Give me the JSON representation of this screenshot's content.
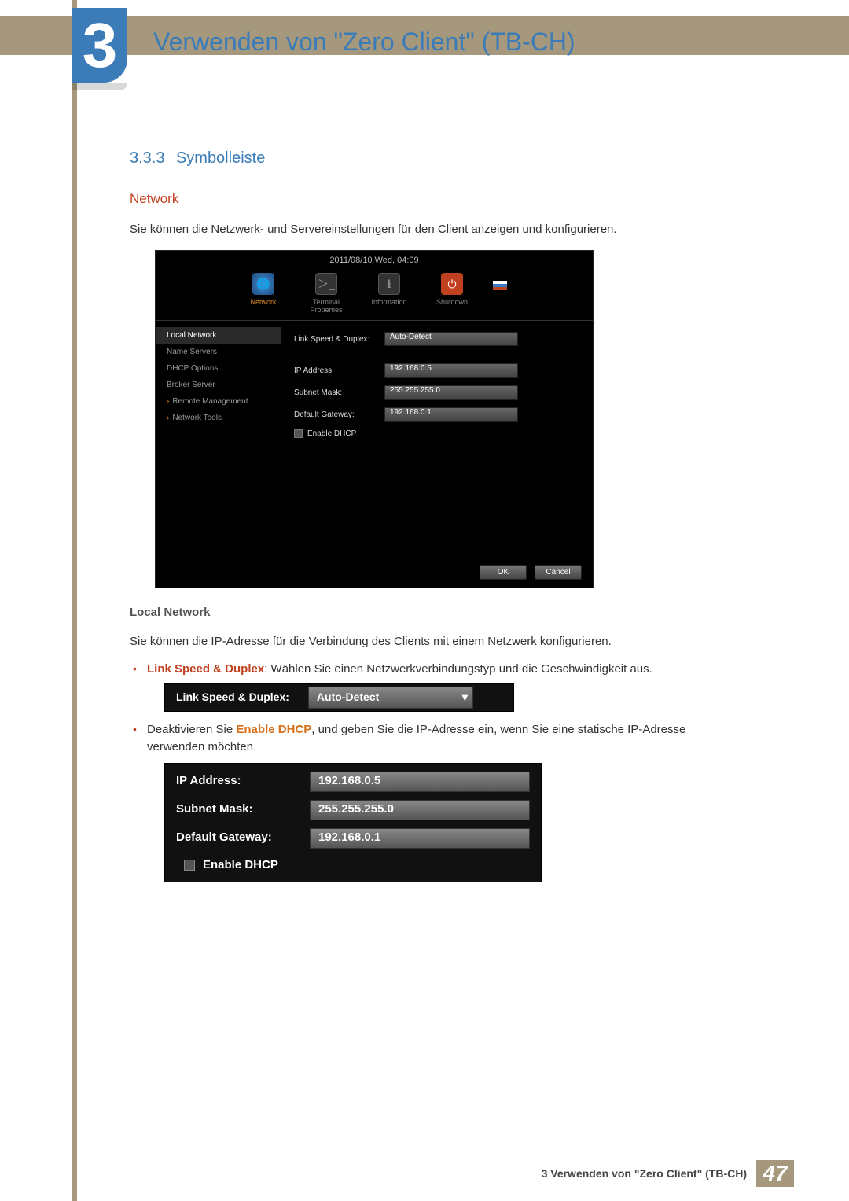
{
  "chapter": {
    "num": "3",
    "title": "Verwenden von \"Zero Client\" (TB-CH)"
  },
  "section": {
    "num": "3.3.3",
    "title": "Symbolleiste"
  },
  "networkHeading": "Network",
  "intro": "Sie können die Netzwerk- und Servereinstellungen für den Client anzeigen und konfigurieren.",
  "shot": {
    "datetime": "2011/08/10 Wed, 04:09",
    "toolbar": [
      "Network",
      "Terminal Properties",
      "Information",
      "Shutdown"
    ],
    "side": [
      "Local Network",
      "Name Servers",
      "DHCP Options",
      "Broker Server",
      "Remote Management",
      "Network Tools"
    ],
    "form": {
      "linkSpeedLabel": "Link Speed & Duplex:",
      "linkSpeedValue": "Auto-Detect",
      "ipLabel": "IP Address:",
      "ipValue": "192.168.0.5",
      "subnetLabel": "Subnet Mask:",
      "subnetValue": "255.255.255.0",
      "gwLabel": "Default Gateway:",
      "gwValue": "192.168.0.1",
      "dhcp": "Enable DHCP"
    },
    "ok": "OK",
    "cancel": "Cancel"
  },
  "subHeading": "Local Network",
  "subIntro": "Sie können die IP-Adresse für die Verbindung des Clients mit einem Netzwerk konfigurieren.",
  "bullet1": {
    "bold": "Link Speed & Duplex",
    "rest": ": Wählen Sie einen Netzwerkverbindungstyp und die Geschwindigkeit aus."
  },
  "snip1": {
    "label": "Link Speed & Duplex:",
    "value": "Auto-Detect"
  },
  "bullet2": {
    "pre": "Deaktivieren Sie ",
    "bold": "Enable DHCP",
    "rest": ", und geben Sie die IP-Adresse ein, wenn Sie eine statische IP-Adresse verwenden möchten."
  },
  "snip2": {
    "ipLabel": "IP Address:",
    "ipValue": "192.168.0.5",
    "smLabel": "Subnet Mask:",
    "smValue": "255.255.255.0",
    "gwLabel": "Default Gateway:",
    "gwValue": "192.168.0.1",
    "dhcp": "Enable DHCP"
  },
  "footer": {
    "text": "3 Verwenden von \"Zero Client\" (TB-CH)",
    "page": "47"
  }
}
